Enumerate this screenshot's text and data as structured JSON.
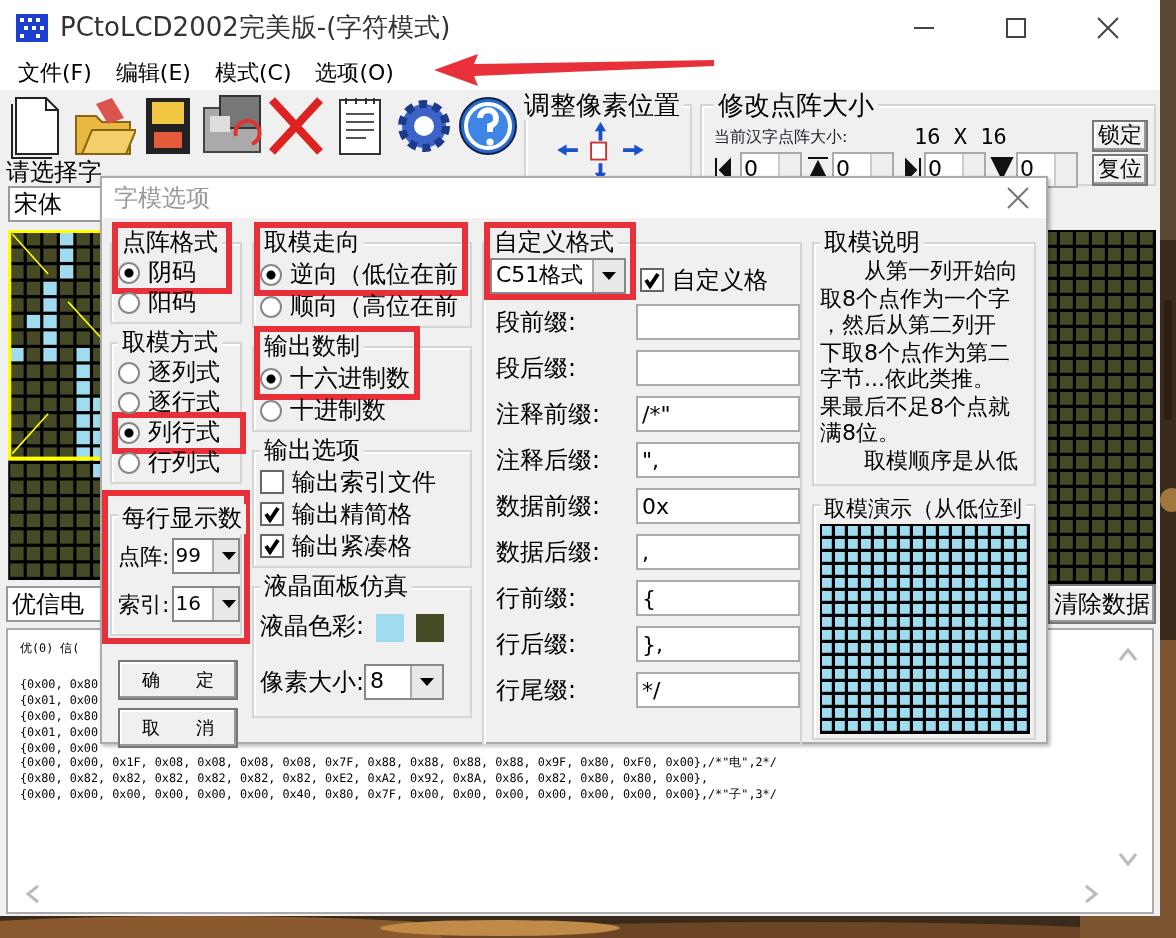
{
  "window": {
    "title": "PCtoLCD2002完美版-(字符模式)"
  },
  "menu": [
    "文件(F)",
    "编辑(E)",
    "模式(C)",
    "选项(O)"
  ],
  "toolbar": [
    {
      "kind": "new"
    },
    {
      "kind": "open"
    },
    {
      "kind": "save"
    },
    {
      "kind": "save_as"
    },
    {
      "kind": "delete"
    },
    {
      "kind": "notes"
    },
    {
      "kind": "settings"
    },
    {
      "kind": "help"
    }
  ],
  "pixel_shift": {
    "title": "调整像素位置"
  },
  "matrix_size": {
    "title": "修改点阵大小",
    "caption": "当前汉字点阵大小:",
    "size": "16 X 16",
    "lock_button": "锁定",
    "reset_button": "复位",
    "spinners": [
      "0",
      "0",
      "0",
      "0"
    ]
  },
  "font": {
    "label": "请选择字",
    "value": "宋体"
  },
  "text_input": {
    "value": "优信电"
  },
  "clear_button": "清除数据",
  "output": {
    "lines": [
      "优(0) 信(",
      "{0x00, 0x80",
      "{0x01, 0x00",
      "{0x00, 0x80",
      "{0x01, 0x00",
      "{0x00, 0x00",
      "{0x00, 0x00, 0x1F, 0x08, 0x08, 0x08, 0x08, 0x7F, 0x88, 0x88, 0x88, 0x88, 0x9F, 0x80, 0xF0, 0x00},/*\"电\",2*/",
      "{0x80, 0x82, 0x82, 0x82, 0x82, 0x82, 0x82, 0xE2, 0xA2, 0x92, 0x8A, 0x86, 0x82, 0x80, 0x80, 0x00},",
      "{0x00, 0x00, 0x00, 0x00, 0x00, 0x00, 0x40, 0x80, 0x7F, 0x00, 0x00, 0x00, 0x00, 0x00, 0x00, 0x00},/*\"子\",3*/"
    ]
  },
  "dialog": {
    "title": "字模选项",
    "dot_format": {
      "title": "点阵格式",
      "head_highlighted": true,
      "options": [
        {
          "label": "阴码",
          "selected": true,
          "highlighted": false
        },
        {
          "label": "阳码",
          "selected": false,
          "highlighted": false
        }
      ]
    },
    "mode": {
      "title": "取模方式",
      "head_highlighted": false,
      "options": [
        {
          "label": "逐列式",
          "selected": false,
          "highlighted": false
        },
        {
          "label": "逐行式",
          "selected": false,
          "highlighted": false
        },
        {
          "label": "列行式",
          "selected": true,
          "highlighted": true
        },
        {
          "label": "行列式",
          "selected": false,
          "highlighted": false
        }
      ]
    },
    "per_line": {
      "title": "每行显示数",
      "highlighted": true,
      "rows": [
        {
          "label": "点阵:",
          "value": "99"
        },
        {
          "label": "索引:",
          "value": "16"
        }
      ]
    },
    "ok_button": "确　　定",
    "cancel_button": "取　　消",
    "direction": {
      "title": "取模走向",
      "head_highlighted": true,
      "options": [
        {
          "label": "逆向（低位在前",
          "selected": true,
          "highlighted": false
        },
        {
          "label": "顺向（高位在前",
          "selected": false,
          "highlighted": false
        }
      ]
    },
    "radix": {
      "title": "输出数制",
      "head_highlighted": true,
      "options": [
        {
          "label": "十六进制数",
          "selected": true,
          "highlighted": false
        },
        {
          "label": "十进制数",
          "selected": false,
          "highlighted": false
        }
      ]
    },
    "output_options": {
      "title": "输出选项",
      "checks": [
        {
          "label": "输出索引文件",
          "checked": false
        },
        {
          "label": "输出精简格",
          "checked": true
        },
        {
          "label": "输出紧凑格",
          "checked": true
        }
      ]
    },
    "lcd": {
      "title": "液晶面板仿真",
      "color_label": "液晶色彩:",
      "swatches": [
        {
          "color": "#a0dcef"
        },
        {
          "color": "#474b25"
        }
      ],
      "pixel_label": "像素大小:",
      "pixel_size": "8"
    },
    "custom": {
      "title": "自定义格式",
      "head_highlighted": true,
      "preset": "C51格式",
      "enabled": {
        "label": "自定义格",
        "checked": true
      },
      "fields": [
        {
          "label": "段前缀:"
        },
        {
          "label": "段后缀:"
        },
        {
          "label": "注释前缀:",
          "value": "/*\""
        },
        {
          "label": "注释后缀:",
          "value": "\","
        },
        {
          "label": "数据前缀:",
          "value": "0x"
        },
        {
          "label": "数据后缀:",
          "value": ","
        },
        {
          "label": "行前缀:",
          "value": "{"
        },
        {
          "label": "行后缀:",
          "value": "},"
        },
        {
          "label": "行尾缀:",
          "value": "*/"
        }
      ]
    },
    "description": {
      "title": "取模说明",
      "lines": [
        "　　从第一列开始向",
        "取8个点作为一个字",
        "，然后从第二列开",
        "下取8个点作为第二",
        "字节...依此类推。",
        "果最后不足8个点就",
        "满8位。",
        "　　取模顺序是从低"
      ]
    },
    "demo": {
      "title": "取模演示（从低位到"
    }
  }
}
